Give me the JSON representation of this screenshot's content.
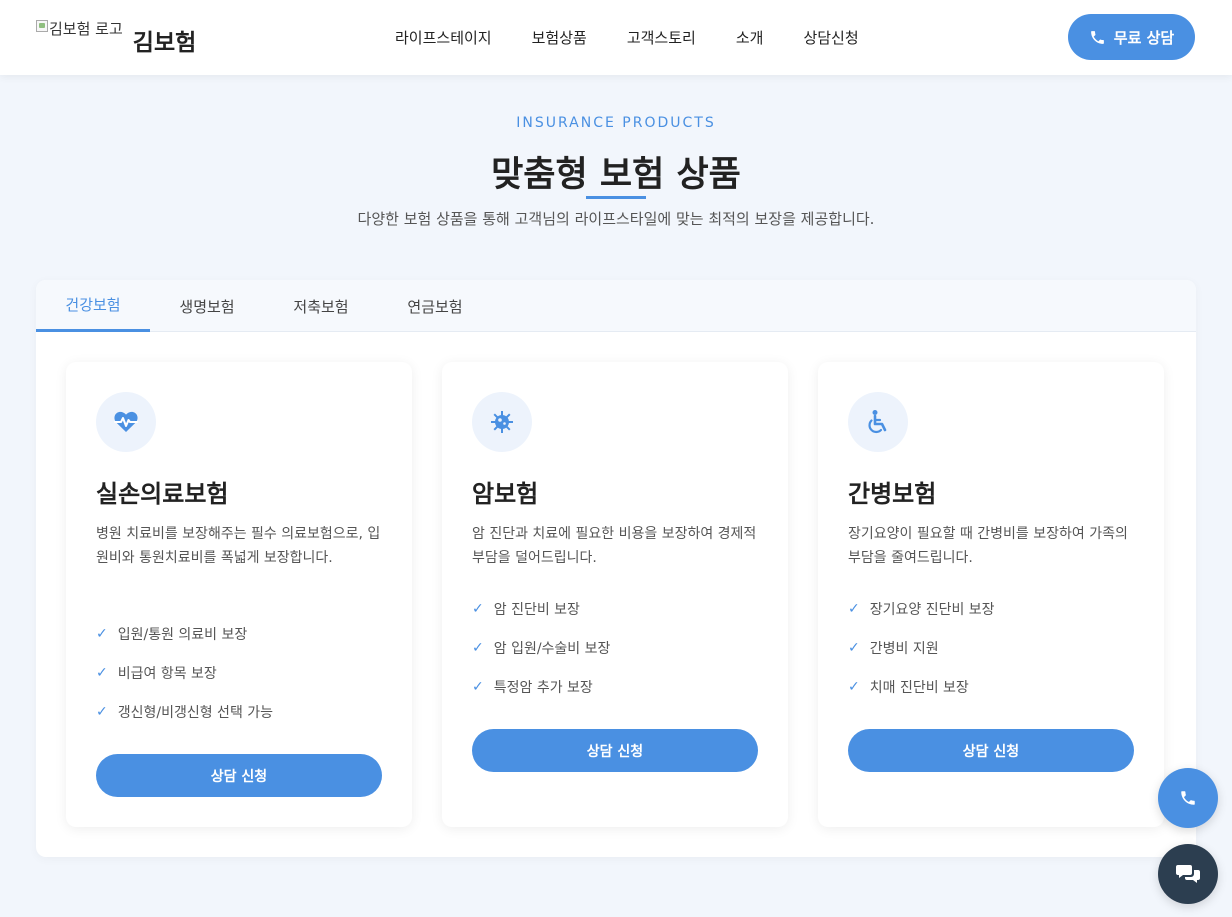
{
  "header": {
    "logo_alt": "김보험 로고",
    "logo_name": "김보험",
    "nav": [
      "라이프스테이지",
      "보험상품",
      "고객스토리",
      "소개",
      "상담신청"
    ],
    "cta_label": "무료 상담"
  },
  "section": {
    "eyebrow": "INSURANCE PRODUCTS",
    "title": "맞춤형 보험 상품",
    "description": "다양한 보험 상품을 통해 고객님의 라이프스타일에 맞는 최적의 보장을 제공합니다."
  },
  "tabs": [
    "건강보험",
    "생명보험",
    "저축보험",
    "연금보험"
  ],
  "active_tab": "건강보험",
  "cards": [
    {
      "icon": "heartbeat-icon",
      "title": "실손의료보험",
      "description": "병원 치료비를 보장해주는 필수 의료보험으로, 입원비와 통원치료비를 폭넓게 보장합니다.",
      "features": [
        "입원/통원 의료비 보장",
        "비급여 항목 보장",
        "갱신형/비갱신형 선택 가능"
      ],
      "button": "상담 신청"
    },
    {
      "icon": "virus-icon",
      "title": "암보험",
      "description": "암 진단과 치료에 필요한 비용을 보장하여 경제적 부담을 덜어드립니다.",
      "features": [
        "암 진단비 보장",
        "암 입원/수술비 보장",
        "특정암 추가 보장"
      ],
      "button": "상담 신청"
    },
    {
      "icon": "wheelchair-icon",
      "title": "간병보험",
      "description": "장기요양이 필요할 때 간병비를 보장하여 가족의 부담을 줄여드립니다.",
      "features": [
        "장기요양 진단비 보장",
        "간병비 지원",
        "치매 진단비 보장"
      ],
      "button": "상담 신청"
    }
  ],
  "check_mark": "✓",
  "colors": {
    "accent": "#4a90e2",
    "dark": "#2c3e50",
    "background": "#f2f6fc"
  }
}
